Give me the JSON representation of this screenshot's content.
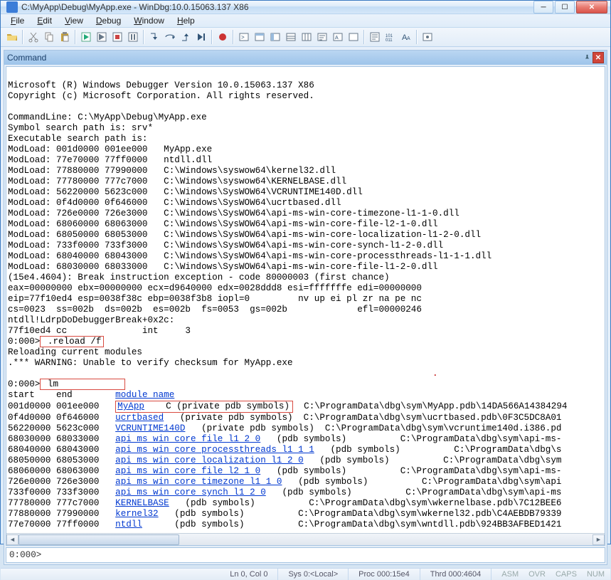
{
  "window": {
    "title": "C:\\MyApp\\Debug\\MyApp.exe - WinDbg:10.0.15063.137 X86"
  },
  "menu": {
    "items": [
      "File",
      "Edit",
      "View",
      "Debug",
      "Window",
      "Help"
    ]
  },
  "panel": {
    "title": "Command"
  },
  "console": {
    "header1": "Microsoft (R) Windows Debugger Version 10.0.15063.137 X86",
    "header2": "Copyright (c) Microsoft Corporation. All rights reserved.",
    "cmdline": "CommandLine: C:\\MyApp\\Debug\\MyApp.exe",
    "symsearch": "Symbol search path is: srv*",
    "execsearch": "Executable search path is:",
    "modloads": [
      "ModLoad: 001d0000 001ee000   MyApp.exe",
      "ModLoad: 77e70000 77ff0000   ntdll.dll",
      "ModLoad: 77880000 77990000   C:\\Windows\\syswow64\\kernel32.dll",
      "ModLoad: 77780000 777c7000   C:\\Windows\\syswow64\\KERNELBASE.dll",
      "ModLoad: 56220000 5623c000   C:\\Windows\\SysWOW64\\VCRUNTIME140D.dll",
      "ModLoad: 0f4d0000 0f646000   C:\\Windows\\SysWOW64\\ucrtbased.dll",
      "ModLoad: 726e0000 726e3000   C:\\Windows\\SysWOW64\\api-ms-win-core-timezone-l1-1-0.dll",
      "ModLoad: 68060000 68063000   C:\\Windows\\SysWOW64\\api-ms-win-core-file-l2-1-0.dll",
      "ModLoad: 68050000 68053000   C:\\Windows\\SysWOW64\\api-ms-win-core-localization-l1-2-0.dll",
      "ModLoad: 733f0000 733f3000   C:\\Windows\\SysWOW64\\api-ms-win-core-synch-l1-2-0.dll",
      "ModLoad: 68040000 68043000   C:\\Windows\\SysWOW64\\api-ms-win-core-processthreads-l1-1-1.dll",
      "ModLoad: 68030000 68033000   C:\\Windows\\SysWOW64\\api-ms-win-core-file-l1-2-0.dll"
    ],
    "break": "(15e4.4604): Break instruction exception - code 80000003 (first chance)",
    "regs1": "eax=00000000 ebx=00000000 ecx=d9640000 edx=0028ddd8 esi=fffffffe edi=00000000",
    "regs2": "eip=77f10ed4 esp=0038f38c ebp=0038f3b8 iopl=0         nv up ei pl zr na pe nc",
    "regs3": "cs=0023  ss=002b  ds=002b  es=002b  fs=0053  gs=002b             efl=00000246",
    "brkfn": "ntdll!LdrpDoDebuggerBreak+0x2c:",
    "brkins": "77f10ed4 cc              int     3",
    "prompt1": "0:000>",
    "reload": " .reload /f",
    "reloading": "Reloading current modules",
    "warn": ".*** WARNING: Unable to verify checksum for MyApp.exe",
    "dot": ".",
    "prompt2": "0:000>",
    "lm": " lm",
    "lmhdr_start": "start    end        ",
    "lmhdr_mod": "module name",
    "lmrows": [
      {
        "se": "001d0000 001ee000   ",
        "mod": "MyApp",
        "rest": "    C (private pdb symbols)",
        "path": "  C:\\ProgramData\\dbg\\sym\\MyApp.pdb\\14DA566A14384294"
      },
      {
        "se": "0f4d0000 0f646000   ",
        "mod": "ucrtbased",
        "rest": "   (private pdb symbols)",
        "path": "  C:\\ProgramData\\dbg\\sym\\ucrtbased.pdb\\0F3C5DC8A01"
      },
      {
        "se": "56220000 5623c000   ",
        "mod": "VCRUNTIME140D",
        "rest": "   (private pdb symbols)",
        "path": "  C:\\ProgramData\\dbg\\sym\\vcruntime140d.i386.pd"
      },
      {
        "se": "68030000 68033000   ",
        "mod": "api_ms_win_core_file_l1_2_0",
        "rest": "   (pdb symbols)",
        "path": "          C:\\ProgramData\\dbg\\sym\\api-ms-"
      },
      {
        "se": "68040000 68043000   ",
        "mod": "api_ms_win_core_processthreads_l1_1_1",
        "rest": "   (pdb symbols)",
        "path": "          C:\\ProgramData\\dbg\\s"
      },
      {
        "se": "68050000 68053000   ",
        "mod": "api_ms_win_core_localization_l1_2_0",
        "rest": "   (pdb symbols)",
        "path": "          C:\\ProgramData\\dbg\\sym"
      },
      {
        "se": "68060000 68063000   ",
        "mod": "api_ms_win_core_file_l2_1_0",
        "rest": "   (pdb symbols)",
        "path": "          C:\\ProgramData\\dbg\\sym\\api-ms-"
      },
      {
        "se": "726e0000 726e3000   ",
        "mod": "api_ms_win_core_timezone_l1_1_0",
        "rest": "   (pdb symbols)",
        "path": "          C:\\ProgramData\\dbg\\sym\\api"
      },
      {
        "se": "733f0000 733f3000   ",
        "mod": "api_ms_win_core_synch_l1_2_0",
        "rest": "   (pdb symbols)",
        "path": "          C:\\ProgramData\\dbg\\sym\\api-ms"
      },
      {
        "se": "77780000 777c7000   ",
        "mod": "KERNELBASE",
        "rest": "   (pdb symbols)",
        "path": "          C:\\ProgramData\\dbg\\sym\\wkernelbase.pdb\\7C12BEE6"
      },
      {
        "se": "77880000 77990000   ",
        "mod": "kernel32",
        "rest": "   (pdb symbols)",
        "path": "          C:\\ProgramData\\dbg\\sym\\wkernel32.pdb\\C4AEBDB79339"
      },
      {
        "se": "77e70000 77ff0000   ",
        "mod": "ntdll",
        "rest": "      (pdb symbols)",
        "path": "          C:\\ProgramData\\dbg\\sym\\wntdll.pdb\\924BB3AFBED1421"
      }
    ]
  },
  "input": {
    "prompt": "0:000>",
    "value": ""
  },
  "status": {
    "pos": "Ln 0, Col 0",
    "sys": "Sys 0:<Local>",
    "proc": "Proc 000:15e4",
    "thrd": "Thrd 000:4604",
    "asm": "ASM",
    "ovr": "OVR",
    "caps": "CAPS",
    "num": "NUM"
  }
}
